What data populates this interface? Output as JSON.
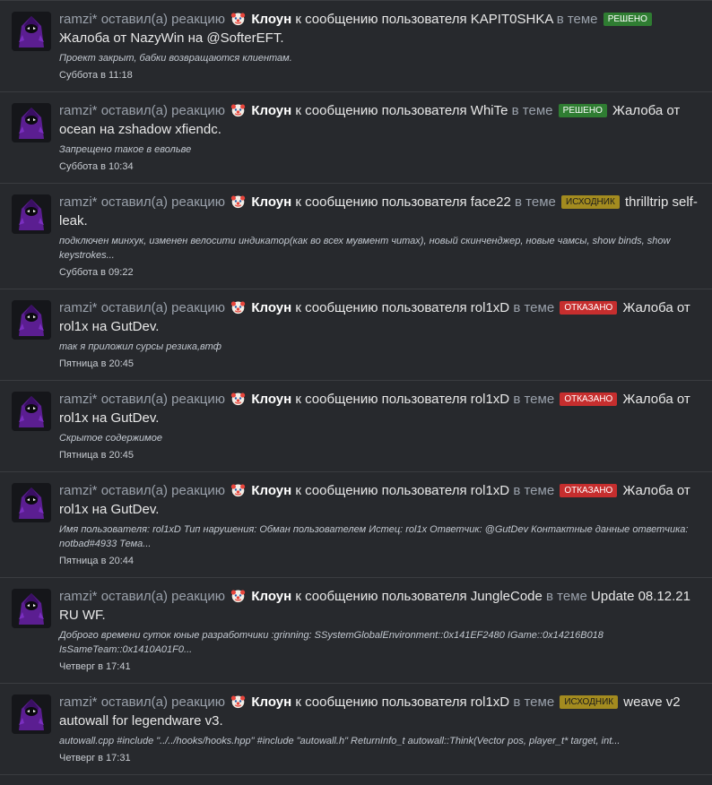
{
  "colors": {
    "background": "#27292d",
    "solved": "#2f7d32",
    "source": "#a38b1f",
    "denied": "#c62e2e"
  },
  "common": {
    "user": "ramzi*",
    "verb": "оставил(а) реакцию",
    "reaction": "Клоун",
    "to_message": "к сообщению пользователя",
    "in_thread": "в теме",
    "emoji_icon": "clown-face-icon"
  },
  "items": [
    {
      "author": "KAPIT0SHKA",
      "prefix": "РЕШЕНО",
      "prefix_type": "solved",
      "thread": "Жалоба от NazyWin на @SofterEFT.",
      "snippet": "Проект закрыт, бабки возвращаются клиентам.",
      "time": "Суббота в 11:18"
    },
    {
      "author": "WhiTe",
      "prefix": "РЕШЕНО",
      "prefix_type": "solved",
      "thread": "Жалоба от ocean на zshadow xfiendc.",
      "snippet": "Запрещено такое в евольве",
      "time": "Суббота в 10:34"
    },
    {
      "author": "face22",
      "prefix": "ИСХОДНИК",
      "prefix_type": "source",
      "thread": "thrilltrip self-leak.",
      "snippet": "подключен минхук, изменен велосити индикатор(как во всех мувмент читах), новый скинченджер, новые чамсы, show binds, show keystrokes...",
      "time": "Суббота в 09:22"
    },
    {
      "author": "rol1xD",
      "prefix": "ОТКАЗАНО",
      "prefix_type": "denied",
      "thread": "Жалоба от rol1x на GutDev.",
      "snippet": "так я приложил сурсы резика,втф",
      "time": "Пятница в 20:45"
    },
    {
      "author": "rol1xD",
      "prefix": "ОТКАЗАНО",
      "prefix_type": "denied",
      "thread": "Жалоба от rol1x на GutDev.",
      "snippet": "Скрытое содержимое",
      "time": "Пятница в 20:45"
    },
    {
      "author": "rol1xD",
      "prefix": "ОТКАЗАНО",
      "prefix_type": "denied",
      "thread": "Жалоба от rol1x на GutDev.",
      "snippet": "Имя пользователя: rol1xD Тип нарушения: Обман пользователем Истец: rol1x Ответчик: @GutDev Контактные данные ответчика: notbad#4933 Тема...",
      "time": "Пятница в 20:44"
    },
    {
      "author": "JungleCode",
      "prefix": "",
      "prefix_type": "",
      "thread": "Update 08.12.21 RU WF.",
      "snippet": "Доброго времени суток юные разработчики :grinning: SSystemGlobalEnvironment::0x141EF2480 IGame::0x14216B018 IsSameTeam::0x1410A01F0...",
      "time": "Четверг в 17:41"
    },
    {
      "author": "rol1xD",
      "prefix": "ИСХОДНИК",
      "prefix_type": "source",
      "thread": "weave v2 autowall for legendware v3.",
      "snippet": "autowall.cpp #include \"../../hooks/hooks.hpp\" #include \"autowall.h\" ReturnInfo_t autowall::Think(Vector pos, player_t* target, int...",
      "time": "Четверг в 17:31"
    }
  ]
}
